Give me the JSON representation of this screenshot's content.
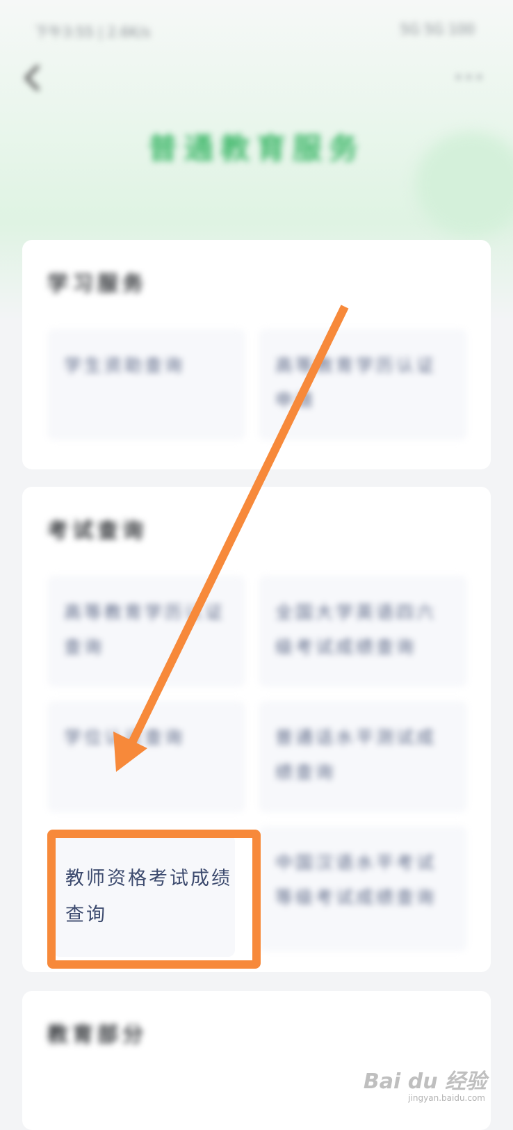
{
  "status_bar": {
    "left_text": "下午3:55 | 2.6K/s",
    "right_text": "5G 5G 100"
  },
  "header": {
    "more_label": "•••",
    "title": "普通教育服务"
  },
  "section1": {
    "title": "学习服务",
    "tiles": [
      {
        "label": "学生资助查询"
      },
      {
        "label": "高等教育学历认证申请"
      }
    ]
  },
  "section2": {
    "title": "考试查询",
    "tiles": [
      {
        "label": "高等教育学历认证查询"
      },
      {
        "label": "全国大学英语四六级考试成绩查询"
      },
      {
        "label": "学位认证查询"
      },
      {
        "label": "普通话水平测试成绩查询"
      },
      {
        "label": "教师资格考试成绩查询"
      },
      {
        "label": "中国汉语水平考试等级考试成绩查询"
      }
    ]
  },
  "section3": {
    "title": "教育部分"
  },
  "watermark": {
    "brand": "Bai du 经验",
    "url": "jingyan.baidu.com"
  },
  "colors": {
    "accent": "#f7893a",
    "title_green": "#3fb86a",
    "tile_text": "#5b6786"
  }
}
